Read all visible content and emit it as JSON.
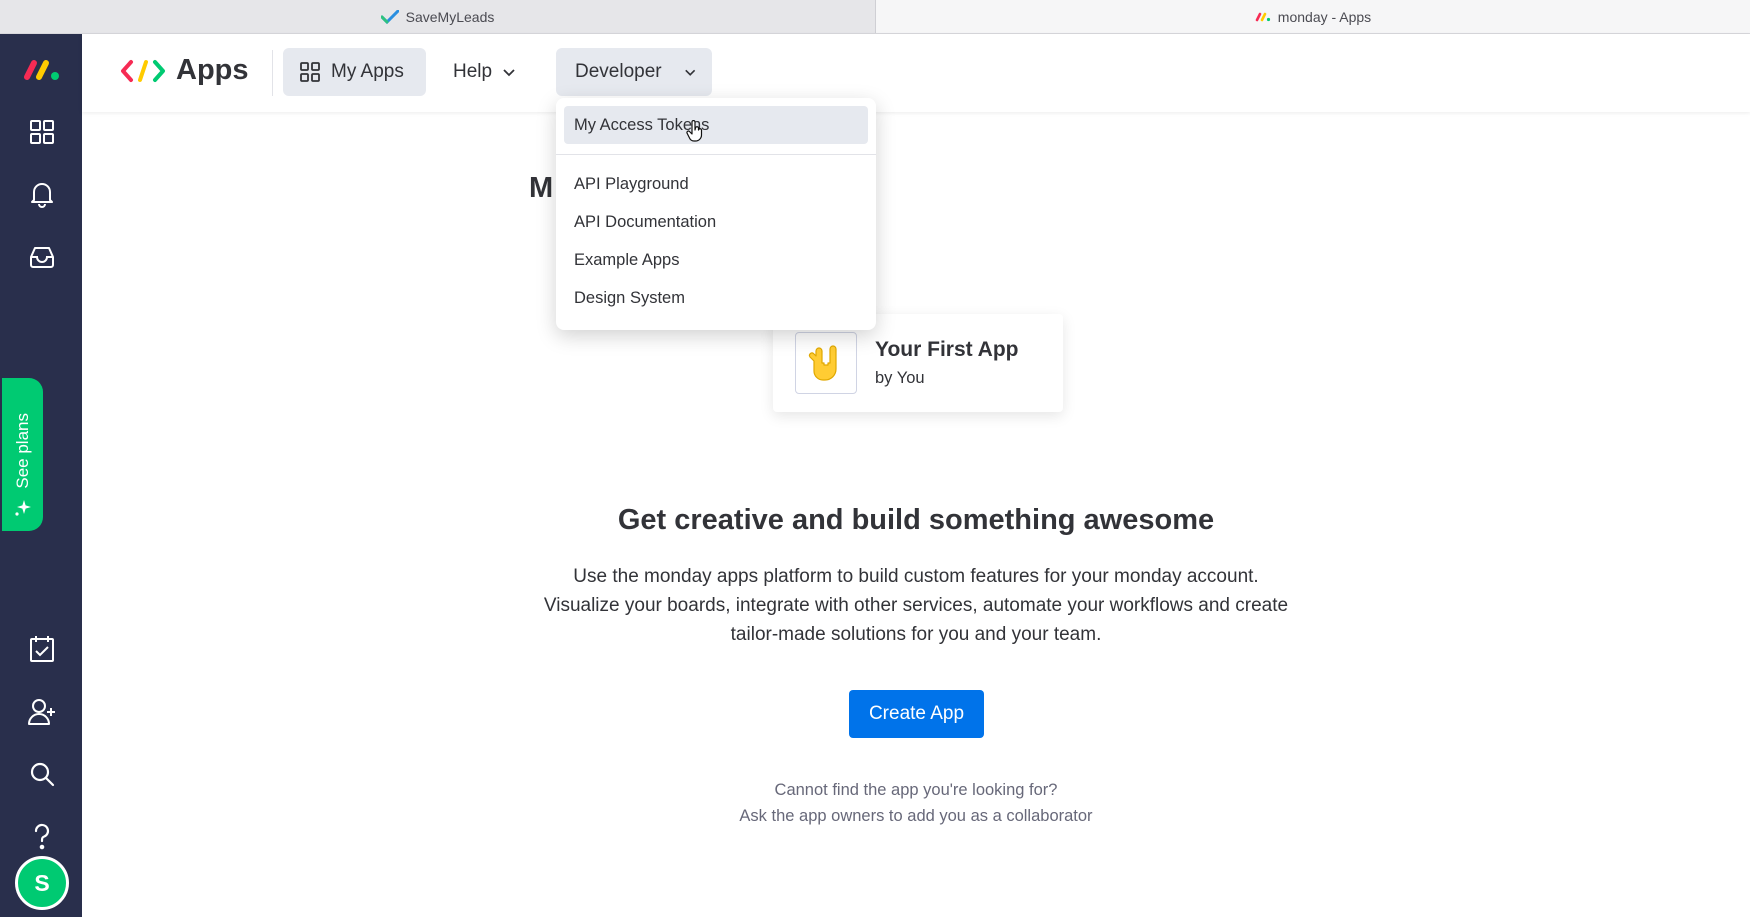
{
  "browser": {
    "tabs": [
      {
        "label": "SaveMyLeads",
        "icon": "savemyleads-check-icon",
        "active": false
      },
      {
        "label": "monday - Apps",
        "icon": "monday-logo-icon",
        "active": true
      }
    ]
  },
  "sidebar": {
    "items": [
      {
        "name": "workspace-grid",
        "icon": "grid-icon"
      },
      {
        "name": "notifications",
        "icon": "bell-icon"
      },
      {
        "name": "inbox",
        "icon": "inbox-icon"
      },
      {
        "name": "my-work",
        "icon": "calendar-check-icon"
      },
      {
        "name": "invite-members",
        "icon": "add-user-icon"
      },
      {
        "name": "search",
        "icon": "search-icon"
      },
      {
        "name": "help",
        "icon": "question-icon"
      }
    ],
    "see_plans_label": "See plans",
    "avatar_initial": "S"
  },
  "header": {
    "app_title": "Apps",
    "my_apps_label": "My Apps",
    "help_label": "Help",
    "developer_label": "Developer"
  },
  "developer_menu": {
    "items": [
      {
        "label": "My Access Tokens",
        "active": true
      },
      {
        "label": "API Playground",
        "active": false
      },
      {
        "label": "API Documentation",
        "active": false
      },
      {
        "label": "Example Apps",
        "active": false
      },
      {
        "label": "Design System",
        "active": false
      }
    ]
  },
  "main": {
    "partial_title": "M",
    "sample_app": {
      "name": "Your First App",
      "by": "by You",
      "icon": "rock-hand-emoji-icon"
    },
    "headline": "Get creative and build something awesome",
    "description_lines": [
      "Use the monday apps platform to build custom features for your monday account.",
      "Visualize your boards, integrate with other services, automate your workflows and create",
      "tailor-made solutions for you and your team."
    ],
    "create_button_label": "Create App",
    "hint_lines": [
      "Cannot find the app you're looking for?",
      "Ask the app owners to add you as a collaborator"
    ]
  },
  "colors": {
    "sidebar_bg": "#292f4c",
    "primary_button": "#0073ea",
    "see_plans_green": "#00ca72",
    "active_menu_bg": "#e6e9ef"
  }
}
